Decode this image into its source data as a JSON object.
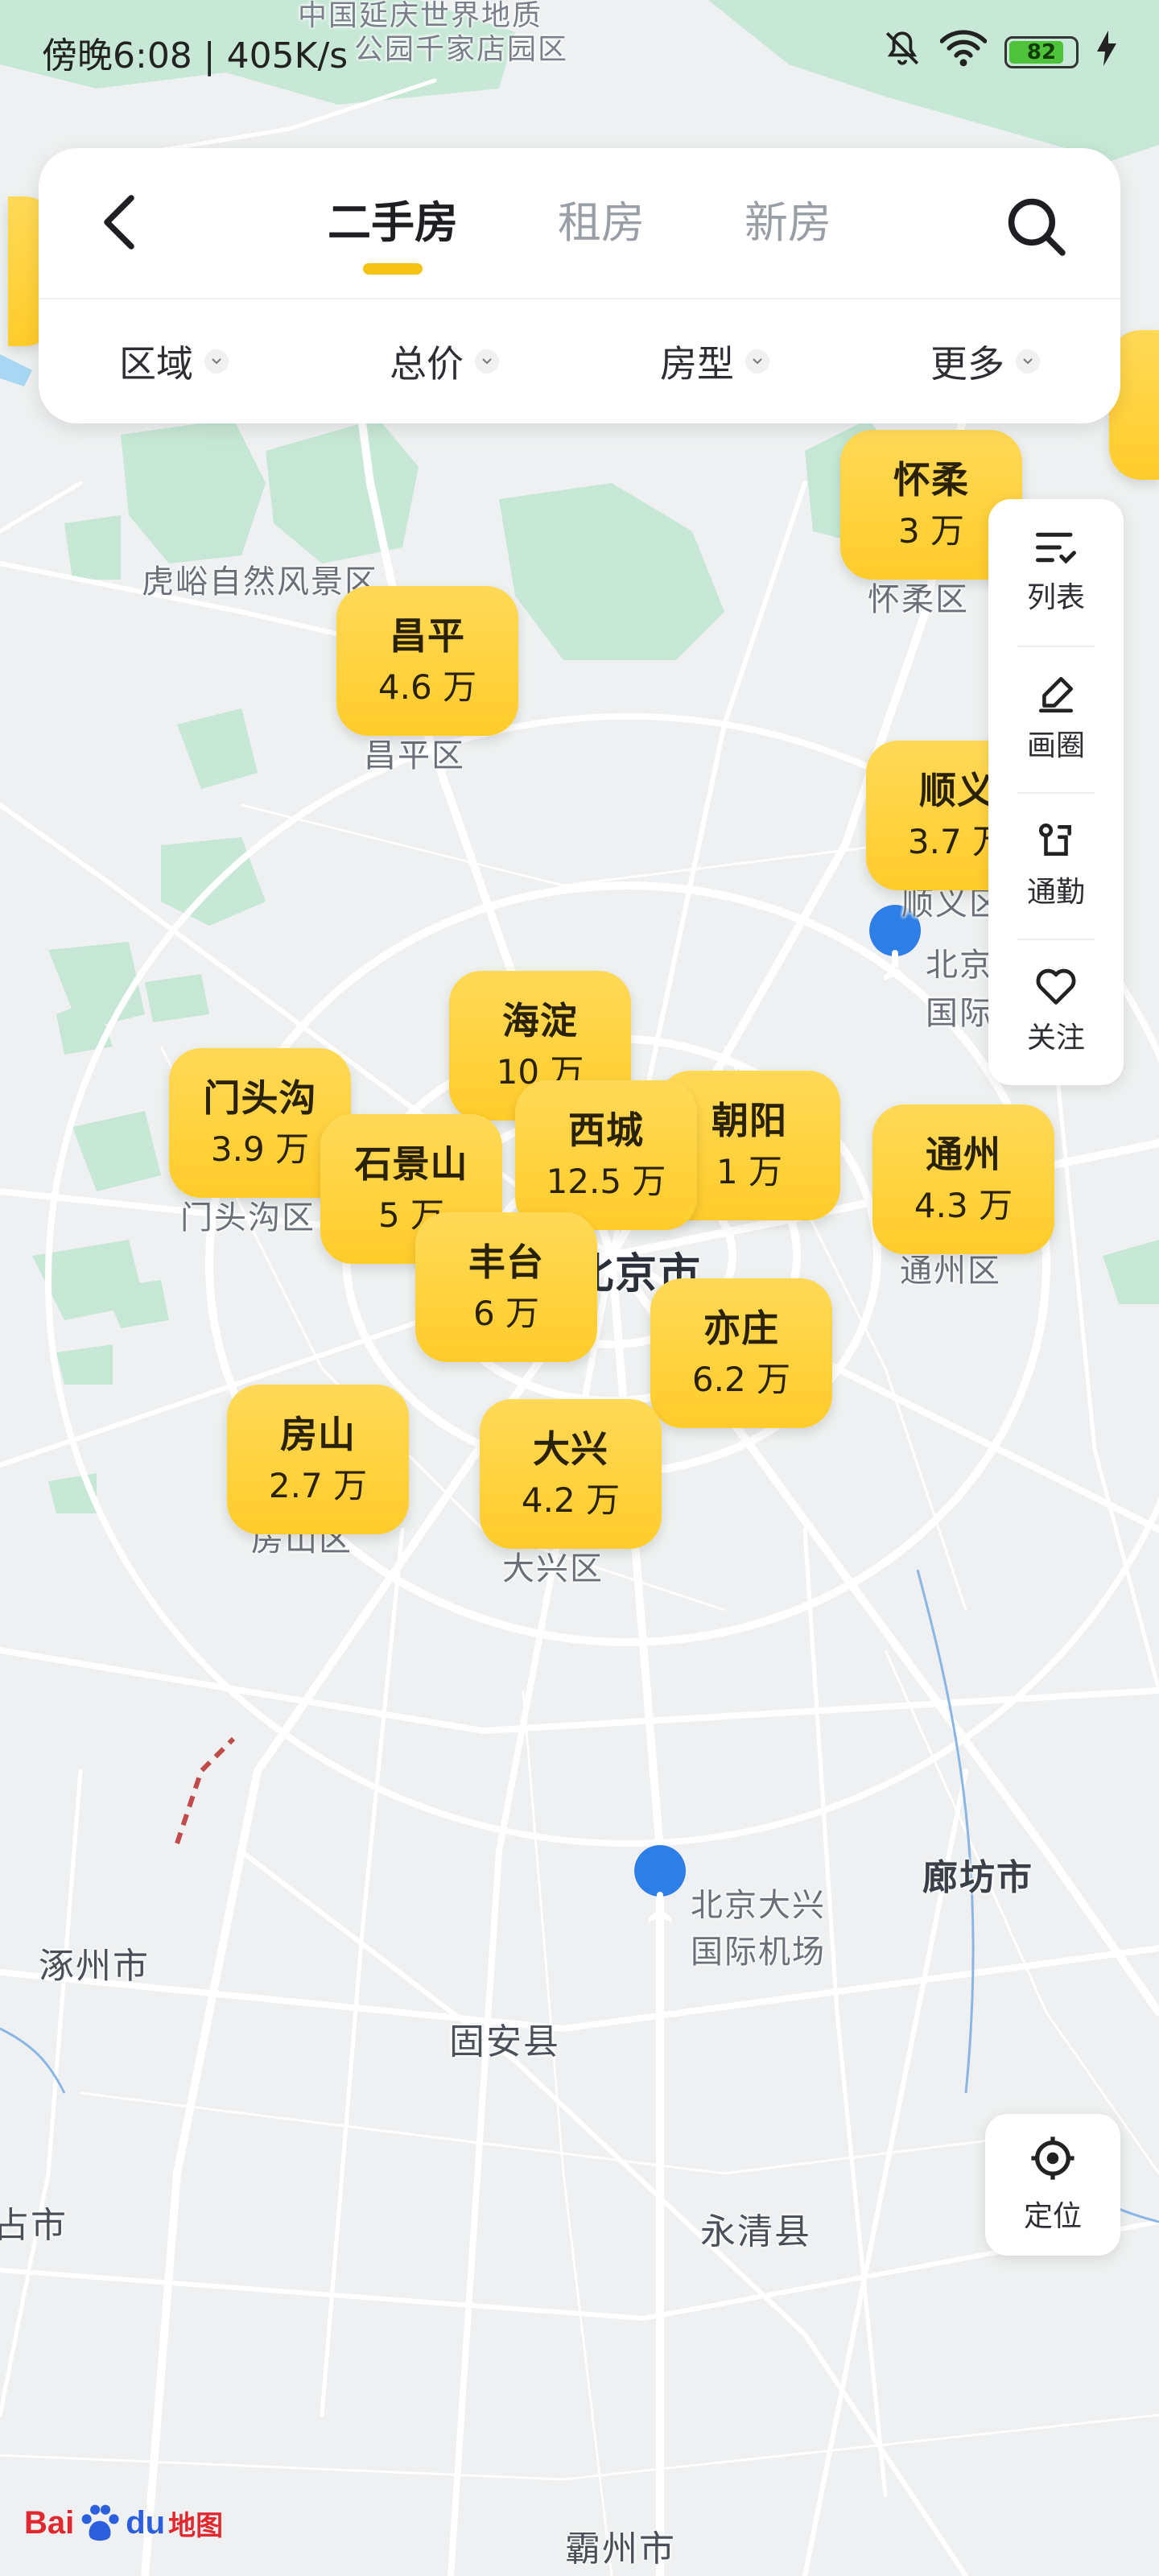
{
  "status": {
    "time_speed": "傍晚6:08 | 405K/s",
    "battery": "82"
  },
  "header": {
    "tabs": [
      {
        "label": "二手房",
        "active": true
      },
      {
        "label": "租房",
        "active": false
      },
      {
        "label": "新房",
        "active": false
      }
    ],
    "filters": [
      "区域",
      "总价",
      "房型",
      "更多"
    ]
  },
  "tools": [
    {
      "label": "列表",
      "icon": "list-icon"
    },
    {
      "label": "画圈",
      "icon": "draw-circle-icon"
    },
    {
      "label": "通勤",
      "icon": "commute-icon"
    },
    {
      "label": "关注",
      "icon": "heart-icon"
    }
  ],
  "locate": {
    "label": "定位",
    "icon": "locate-icon"
  },
  "bubbles": [
    {
      "name": "怀柔",
      "price": "3 万"
    },
    {
      "name": "昌平",
      "price": "4.6 万"
    },
    {
      "name": "顺义",
      "price": "3.7 万"
    },
    {
      "name": "海淀",
      "price": "10 万"
    },
    {
      "name": "门头沟",
      "price": "3.9 万"
    },
    {
      "name": "朝阳",
      "price": "1 万"
    },
    {
      "name": "西城",
      "price": "12.5 万"
    },
    {
      "name": "石景山",
      "price": "5 万"
    },
    {
      "name": "通州",
      "price": "4.3 万"
    },
    {
      "name": "丰台",
      "price": "6 万"
    },
    {
      "name": "亦庄",
      "price": "6.2 万"
    },
    {
      "name": "房山",
      "price": "2.7 万"
    },
    {
      "name": "大兴",
      "price": "4.2 万"
    }
  ],
  "map_labels": {
    "scenic": "虎峪自然风景区",
    "changping": "昌平区",
    "huairou": "怀柔区",
    "shunyi": "顺义区",
    "beijing": "北京市",
    "mentougou": "门头沟区",
    "tongzhou": "通州区",
    "fangshan": "房山区",
    "daxing": "大兴区",
    "capital_airport_1": "北京",
    "capital_airport_2": "国际",
    "daxing_airport_1": "北京大兴",
    "daxing_airport_2": "国际机场",
    "langfang": "廊坊市",
    "zhuozhou": "涿州市",
    "gu_an": "固安县",
    "yongqing": "永清县",
    "bazhou": "霸州市",
    "left_city": "占市",
    "top_label_1": "中国延庆世界地质",
    "top_label_2": "公园千家店园区"
  },
  "logo": {
    "bai": "Bai",
    "du": "du",
    "cn": "地图"
  },
  "colors": {
    "bubble": "#ffcc2a",
    "accent": "#f5c112",
    "road": "#ffffff",
    "green": "#bfe3cf"
  }
}
